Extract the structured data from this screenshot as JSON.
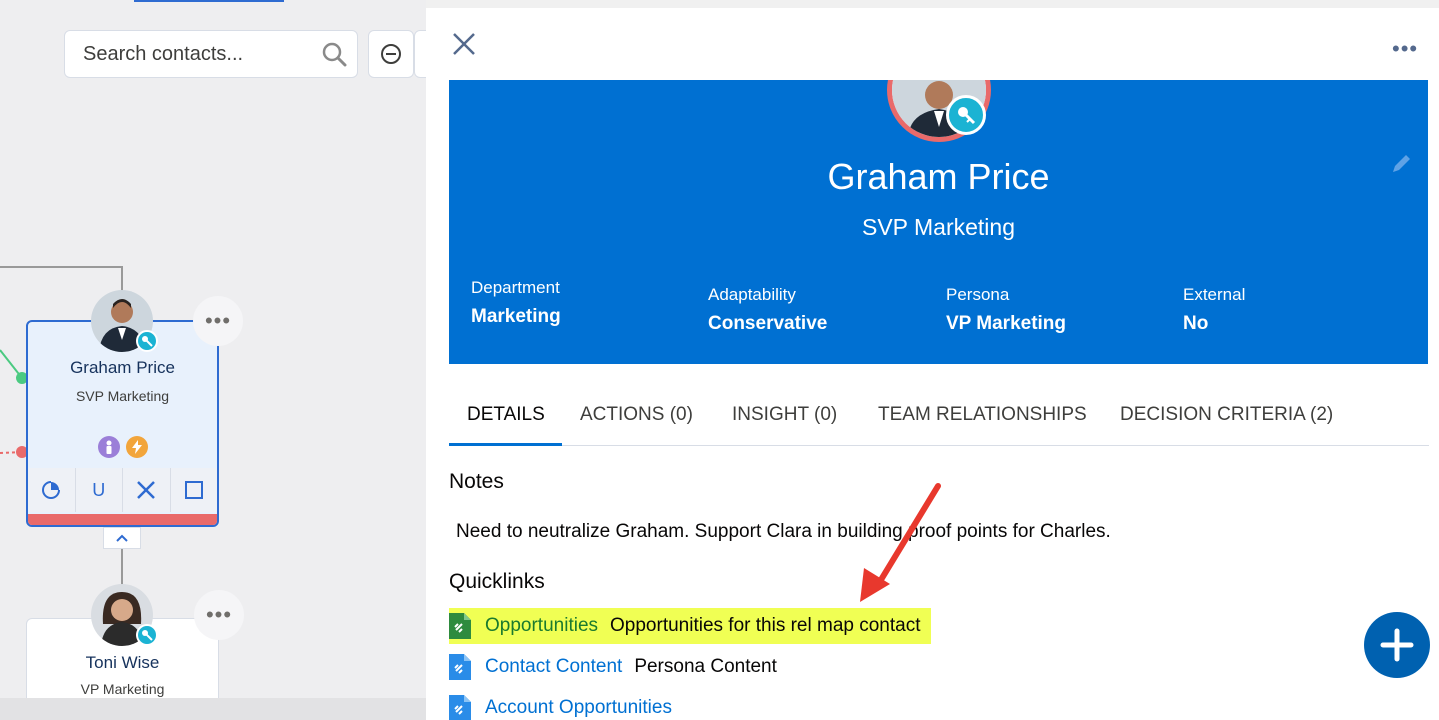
{
  "canvas": {
    "search": {
      "placeholder": "Search contacts..."
    },
    "contacts": [
      {
        "name": "Graham Price",
        "title": "SVP Marketing",
        "selected": true,
        "actions": [
          "refresh",
          "U",
          "remove",
          "square"
        ]
      },
      {
        "name": "Toni Wise",
        "title": "VP Marketing",
        "selected": false
      }
    ],
    "action_u_label": "U"
  },
  "panel": {
    "menu_label": "•••",
    "profile": {
      "name": "Graham Price",
      "title": "SVP Marketing",
      "fields": [
        {
          "label": "Department",
          "value": "Marketing"
        },
        {
          "label": "Adaptability",
          "value": "Conservative"
        },
        {
          "label": "Persona",
          "value": "VP Marketing"
        },
        {
          "label": "External",
          "value": "No"
        }
      ]
    },
    "tabs": [
      "DETAILS",
      "ACTIONS (0)",
      "INSIGHT (0)",
      "TEAM RELATIONSHIPS",
      "DECISION CRITERIA (2)"
    ],
    "notes": {
      "heading": "Notes",
      "text": "Need to neutralize Graham. Support Clara in building proof points for Charles."
    },
    "quicklinks": {
      "heading": "Quicklinks",
      "items": [
        {
          "link": "Opportunities",
          "description": "Opportunities for this rel map contact",
          "icon": "green-doc-link-icon",
          "highlighted": true
        },
        {
          "link": "Contact Content",
          "description": "Persona Content",
          "icon": "blue-doc-link-icon",
          "highlighted": false
        },
        {
          "link": "Account Opportunities",
          "description": "",
          "icon": "blue-doc-link-icon",
          "highlighted": false
        }
      ]
    }
  },
  "colors": {
    "hero_blue": "#0070d2",
    "accent_red": "#e96a6a",
    "key_badge": "#1bb3d3",
    "highlight": "#f0ff54",
    "annotation_arrow": "#e8382d"
  }
}
